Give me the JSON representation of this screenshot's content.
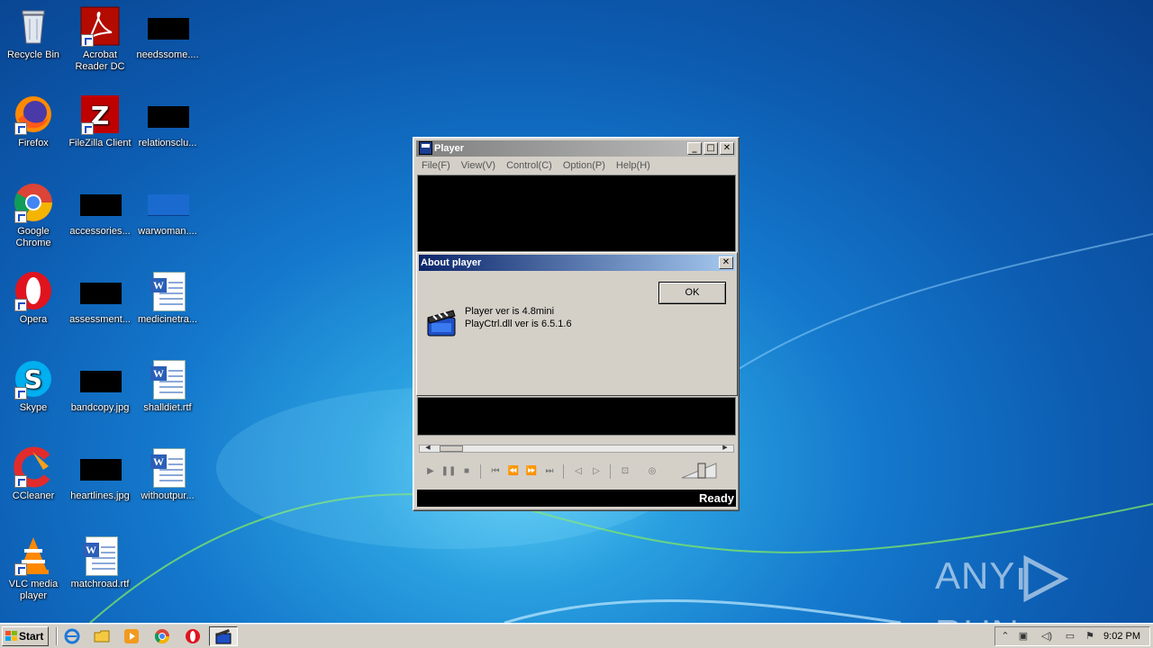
{
  "desktop": {
    "icons": [
      {
        "label": "Recycle Bin"
      },
      {
        "label": "Acrobat Reader DC"
      },
      {
        "label": "needssome...."
      },
      {
        "label": "Firefox"
      },
      {
        "label": "FileZilla Client"
      },
      {
        "label": "relationsclu..."
      },
      {
        "label": "Google Chrome"
      },
      {
        "label": "accessories..."
      },
      {
        "label": "warwoman...."
      },
      {
        "label": "Opera"
      },
      {
        "label": "assessment..."
      },
      {
        "label": "medicinetra..."
      },
      {
        "label": "Skype"
      },
      {
        "label": "bandcopy.jpg"
      },
      {
        "label": "shalldiet.rtf"
      },
      {
        "label": "CCleaner"
      },
      {
        "label": "heartlines.jpg"
      },
      {
        "label": "withoutpur..."
      },
      {
        "label": "VLC media player"
      },
      {
        "label": "matchroad.rtf"
      }
    ]
  },
  "player": {
    "title": "Player",
    "menu": [
      "File(F)",
      "View(V)",
      "Control(C)",
      "Option(P)",
      "Help(H)"
    ],
    "status": "Ready",
    "controls": [
      "play",
      "pause",
      "stop",
      "skip-back",
      "rewind",
      "fast-forward",
      "skip-forward",
      "step-back",
      "step-forward",
      "capture",
      "sound"
    ]
  },
  "about_dialog": {
    "title": "About player",
    "ok_label": "OK",
    "line1": "Player ver is 4.8mini",
    "line2": "PlayCtrl.dll ver is 6.5.1.6"
  },
  "taskbar": {
    "start_label": "Start",
    "clock": "9:02 PM"
  },
  "watermark": {
    "left": "ANY",
    "right": "RUN"
  },
  "colors": {
    "desktop": "#1478cc",
    "dialog_title_start": "#0a246a",
    "dialog_title_end": "#a6caf0"
  }
}
